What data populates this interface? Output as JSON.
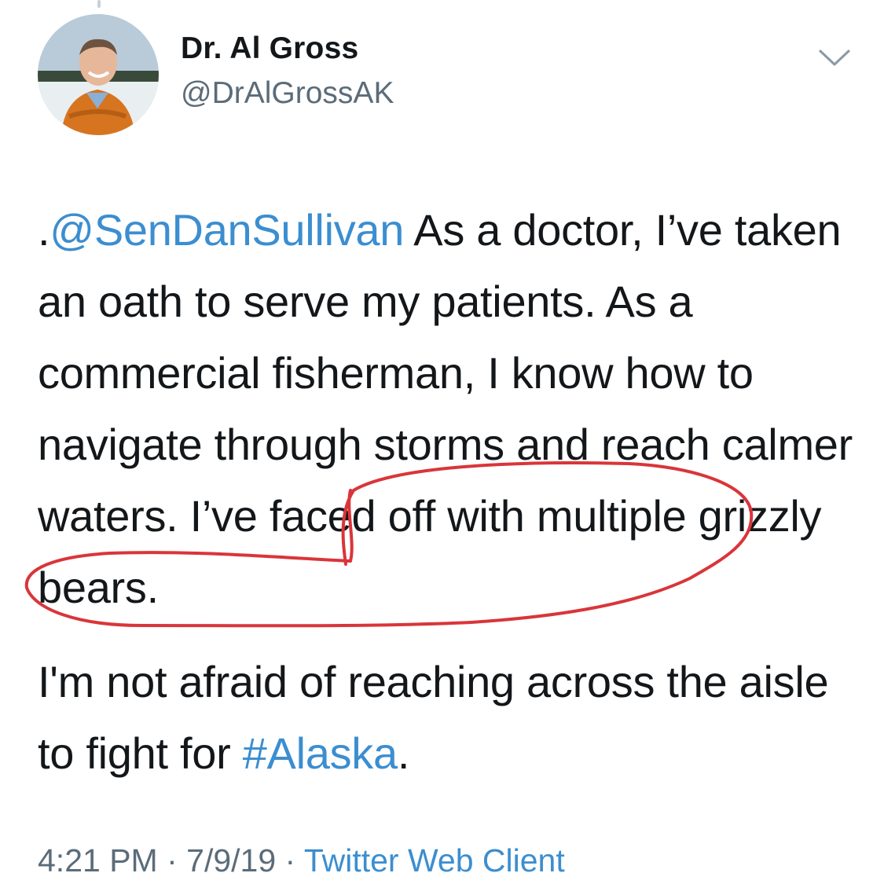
{
  "tweet": {
    "author": {
      "display_name": "Dr. Al Gross",
      "handle": "@DrAlGrossAK"
    },
    "text": {
      "mention_prefix": ".",
      "mention": "@SenDanSullivan",
      "body_1": " As a doctor, I’ve taken an oath to serve my patients. As a commercial fisherman, I know how to navigate through storms and reach calmer waters. I’ve faced off with multiple grizzly bears.",
      "body_2": "I'm not afraid of reaching across the aisle to fight for ",
      "hashtag": "#Alaska",
      "end": "."
    },
    "meta": {
      "time": "4:21 PM",
      "sep1": " · ",
      "date": "7/9/19",
      "sep2": " · ",
      "source": "Twitter Web Client"
    }
  },
  "colors": {
    "link": "#3b8ed0",
    "secondary_text": "#5b6c79",
    "annotation_red": "#d9353a"
  },
  "icons": {
    "more_menu": "chevron-down-icon"
  }
}
